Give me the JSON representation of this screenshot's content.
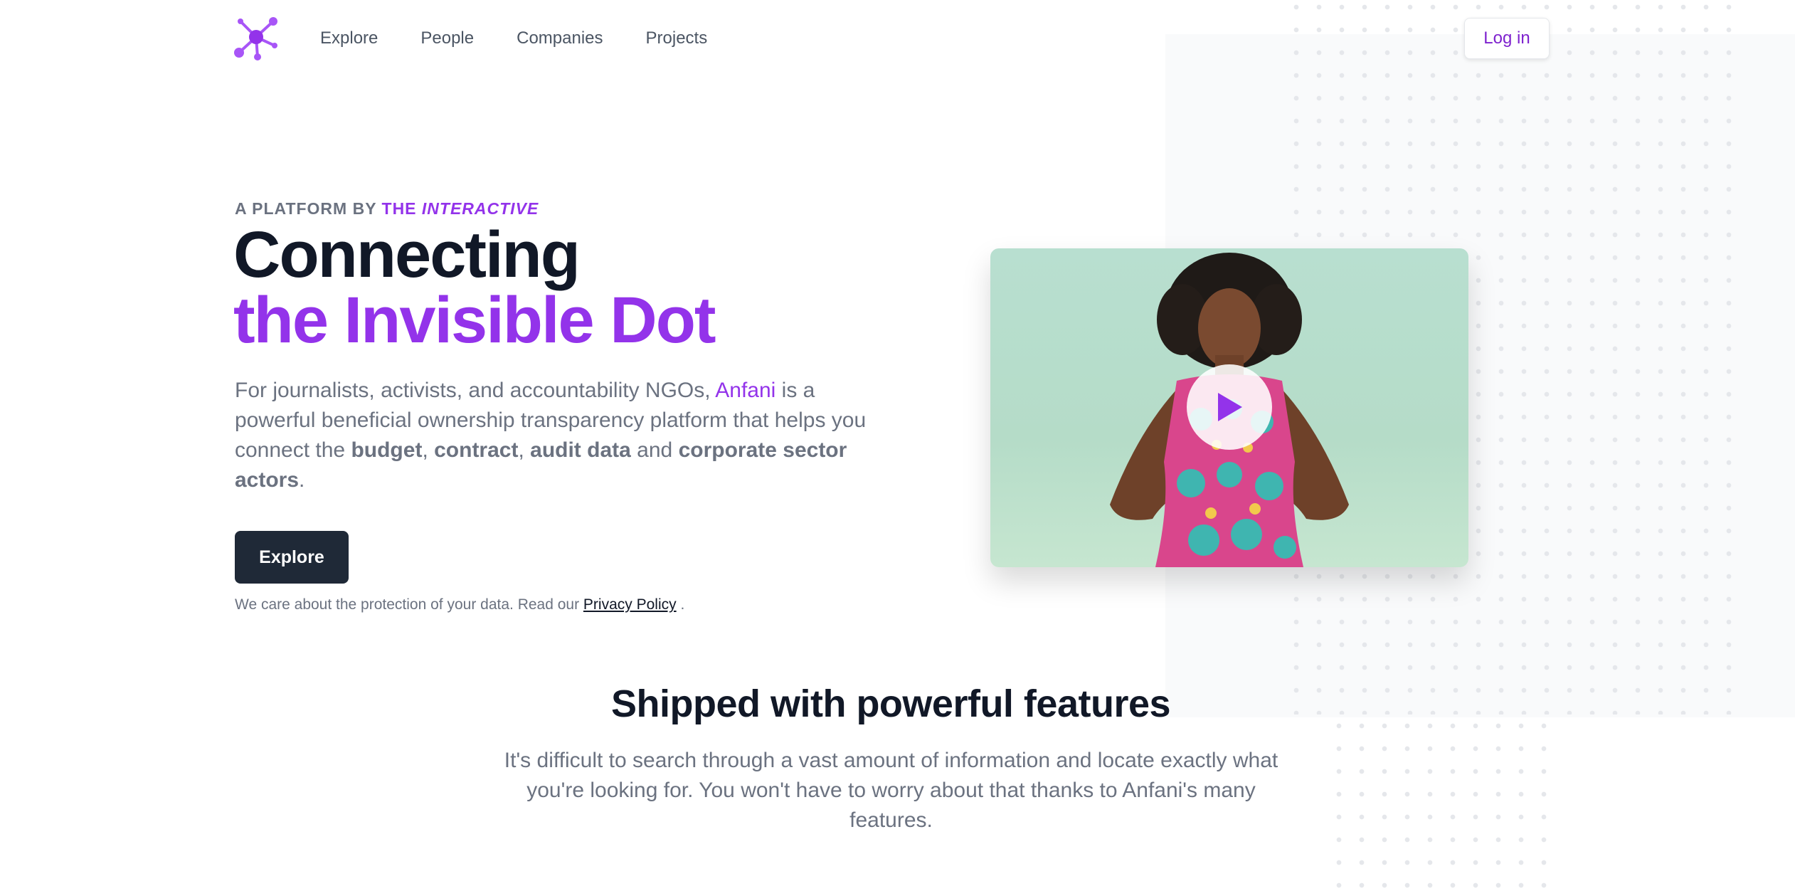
{
  "nav": {
    "logo_icon": "network-nodes-icon",
    "links": [
      {
        "label": "Explore"
      },
      {
        "label": "People"
      },
      {
        "label": "Companies"
      },
      {
        "label": "Projects"
      }
    ],
    "login_label": "Log in"
  },
  "hero": {
    "eyebrow_prefix": "A PLATFORM BY ",
    "eyebrow_the": "THE ",
    "eyebrow_brand": "INTERACTIVE",
    "headline_line1": "Connecting",
    "headline_line2": "the Invisible Dot",
    "lead": {
      "p1": "For journalists, activists, and accountability NGOs, ",
      "brand": "Anfani",
      "p2": " is a powerful beneficial ownership transparency platform that helps you connect the ",
      "b1": "budget",
      "sep1": ", ",
      "b2": "contract",
      "sep2": ", ",
      "b3": "audit data",
      "and": " and ",
      "b4": "corporate sector actors",
      "end": "."
    },
    "cta_label": "Explore",
    "privacy_text": "We care about the protection of your data. Read our ",
    "privacy_link": "Privacy Policy",
    "privacy_end": " ."
  },
  "video": {
    "play_icon": "play-icon"
  },
  "features": {
    "title": "Shipped with powerful features",
    "description": "It's difficult to search through a vast amount of information and locate exactly what you're looking for. You won't have to worry about that thanks to Anfani's many features."
  },
  "colors": {
    "accent": "#9333ea",
    "dark": "#111827",
    "button_dark": "#1f2937",
    "muted": "#6b7280"
  }
}
